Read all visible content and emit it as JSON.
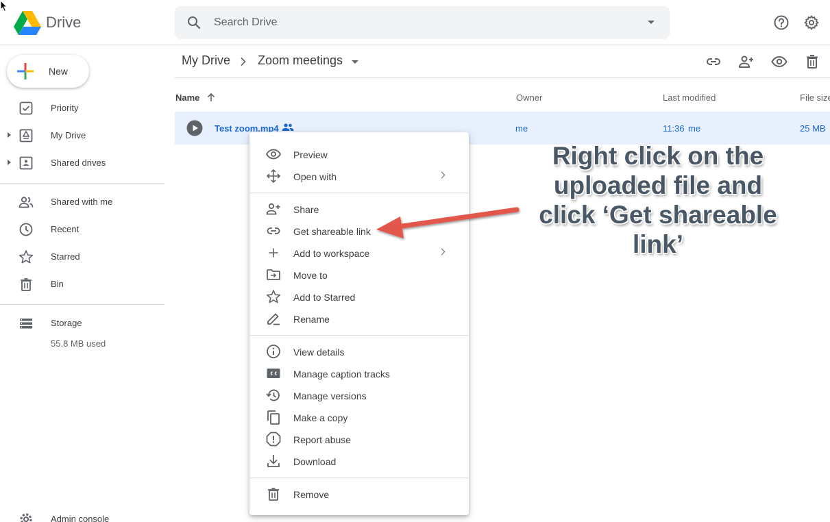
{
  "header": {
    "brand": "Drive",
    "search_placeholder": "Search Drive"
  },
  "sidebar": {
    "new_label": "New",
    "items": [
      {
        "label": "Priority",
        "icon": "priority-icon"
      },
      {
        "label": "My Drive",
        "icon": "my-drive-icon"
      },
      {
        "label": "Shared drives",
        "icon": "shared-drives-icon"
      },
      {
        "label": "Shared with me",
        "icon": "shared-with-me-icon"
      },
      {
        "label": "Recent",
        "icon": "clock-icon"
      },
      {
        "label": "Starred",
        "icon": "star-icon"
      },
      {
        "label": "Bin",
        "icon": "trash-icon"
      },
      {
        "label": "Storage",
        "icon": "storage-icon"
      },
      {
        "label": "Admin console",
        "icon": "gear-icon"
      }
    ],
    "storage_used": "55.8 MB used"
  },
  "breadcrumb": {
    "root": "My Drive",
    "current": "Zoom meetings"
  },
  "table": {
    "headers": {
      "name": "Name",
      "owner": "Owner",
      "modified": "Last modified",
      "size": "File size"
    },
    "rows": [
      {
        "name": "Test zoom.mp4",
        "owner": "me",
        "modified_time": "11:36",
        "modified_by": "me",
        "size": "25 MB"
      }
    ]
  },
  "context_menu": {
    "items": [
      {
        "label": "Preview",
        "icon": "eye-icon"
      },
      {
        "label": "Open with",
        "icon": "move-arrows-icon",
        "submenu": true
      },
      {
        "label": "Share",
        "icon": "add-person-icon"
      },
      {
        "label": "Get shareable link",
        "icon": "link-icon"
      },
      {
        "label": "Add to workspace",
        "icon": "plus-icon",
        "submenu": true
      },
      {
        "label": "Move to",
        "icon": "move-to-folder-icon"
      },
      {
        "label": "Add to Starred",
        "icon": "star-icon"
      },
      {
        "label": "Rename",
        "icon": "pencil-icon"
      },
      {
        "label": "View details",
        "icon": "info-icon"
      },
      {
        "label": "Manage caption tracks",
        "icon": "cc-icon"
      },
      {
        "label": "Manage versions",
        "icon": "history-icon"
      },
      {
        "label": "Make a copy",
        "icon": "copy-icon"
      },
      {
        "label": "Report abuse",
        "icon": "alert-icon"
      },
      {
        "label": "Download",
        "icon": "download-icon"
      },
      {
        "label": "Remove",
        "icon": "trash-icon"
      }
    ]
  },
  "annotation": {
    "lines": [
      "Right click on the",
      "uploaded file and",
      "click ‘Get shareable",
      "link’"
    ],
    "color": "#4a5866",
    "arrow_color": "#e2574c"
  },
  "colors": {
    "selected_row": "#e8f0fe",
    "link_text": "#1967d2"
  }
}
